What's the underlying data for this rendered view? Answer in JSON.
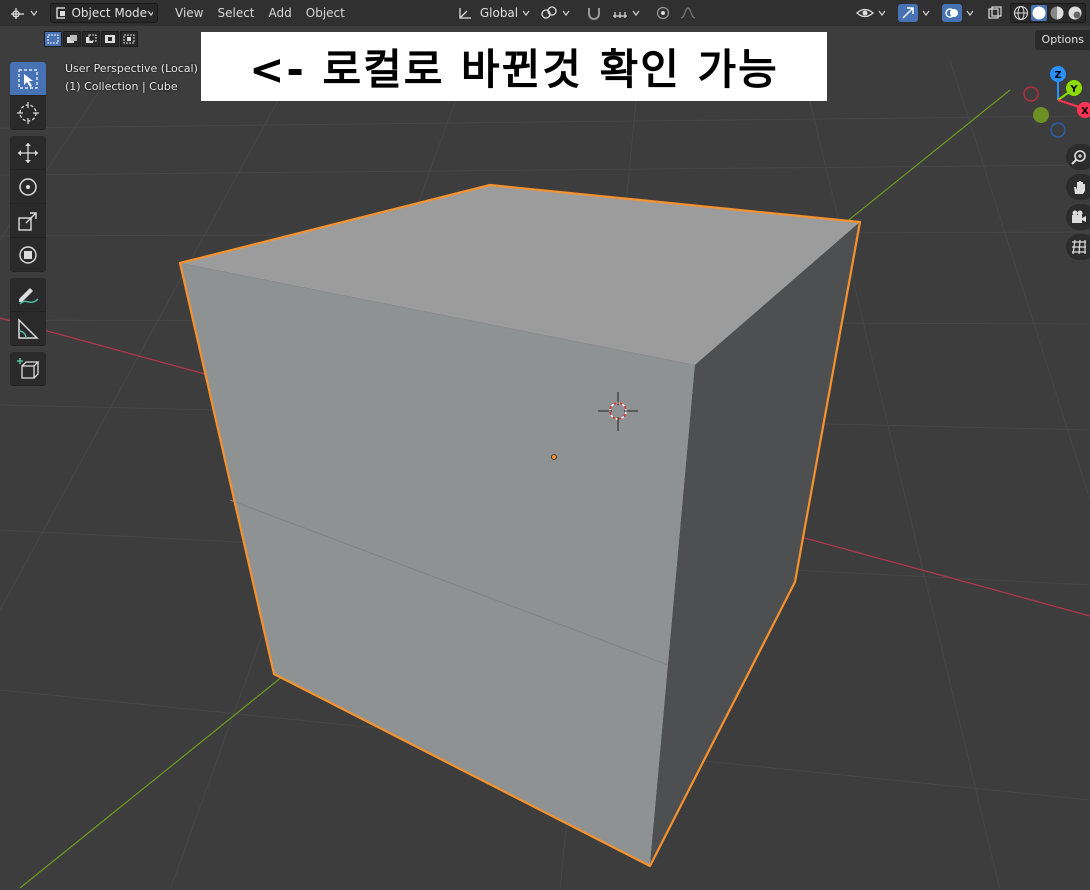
{
  "header": {
    "mode_label": "Object Mode",
    "menus": [
      "View",
      "Select",
      "Add",
      "Object"
    ],
    "orientation_label": "Global"
  },
  "viewport": {
    "perspective_label": "User Perspective (Local)",
    "collection_label": "(1) Collection | Cube",
    "options_label": "Options"
  },
  "annotation": {
    "text": "<- 로컬로 바뀐것 확인 가능"
  },
  "gizmo": {
    "z_label": "Z",
    "y_label": "Y",
    "x_label": "X"
  },
  "colors": {
    "accent": "#4772b3",
    "selection_outline": "#f5922e",
    "x_axis": "#ff3352",
    "y_axis": "#8bdc00",
    "z_axis": "#2890ff"
  },
  "icons": {
    "toolbar": [
      "select-box-icon",
      "cursor-icon",
      "move-icon",
      "rotate-icon",
      "scale-icon",
      "transform-icon",
      "annotate-icon",
      "measure-icon",
      "add-cube-icon"
    ],
    "navigation": [
      "zoom-icon",
      "hand-pan-icon",
      "camera-icon",
      "grid-ortho-icon"
    ]
  }
}
